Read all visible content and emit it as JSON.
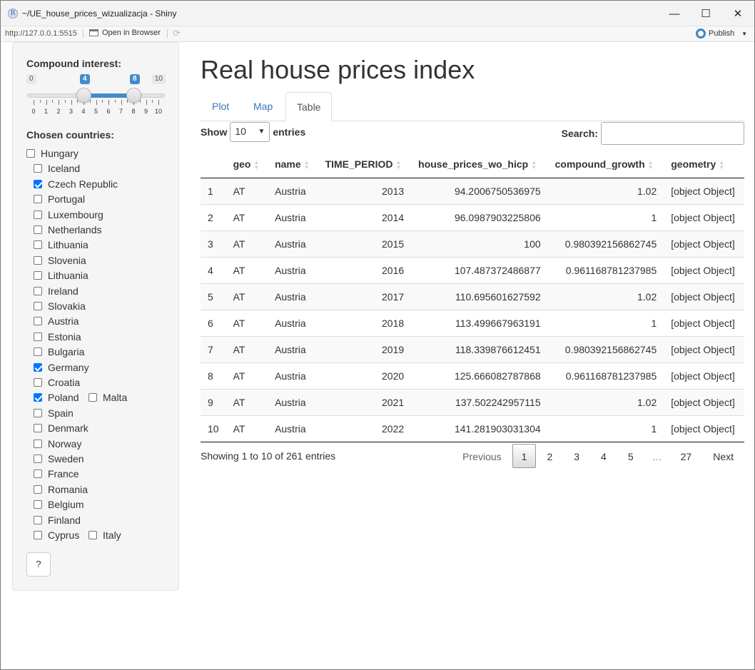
{
  "window": {
    "title": "~/UE_house_prices_wizualizacja - Shiny",
    "app_icon": "R",
    "minimize": "—",
    "maximize": "☐",
    "close": "✕"
  },
  "toolbar": {
    "url": "http://127.0.0.1:5515",
    "open_in_browser": "Open in Browser",
    "publish": "Publish"
  },
  "sidebar": {
    "compound_label": "Compound interest:",
    "slider": {
      "min": 0,
      "max": 10,
      "min_label": "0",
      "max_label": "10",
      "low": 4,
      "high": 8,
      "low_label": "4",
      "high_label": "8",
      "tick_labels": [
        "0",
        "1",
        "2",
        "3",
        "4",
        "5",
        "6",
        "7",
        "8",
        "9",
        "10"
      ]
    },
    "countries_label": "Chosen countries:",
    "countries": [
      {
        "name": "Hungary",
        "checked": false
      },
      {
        "name": "Iceland",
        "checked": false
      },
      {
        "name": "Czech Republic",
        "checked": true
      },
      {
        "name": "Portugal",
        "checked": false
      },
      {
        "name": "Luxembourg",
        "checked": false
      },
      {
        "name": "Netherlands",
        "checked": false
      },
      {
        "name": "Lithuania",
        "checked": false
      },
      {
        "name": "Slovenia",
        "checked": false
      },
      {
        "name": "Lithuania",
        "checked": false
      },
      {
        "name": "Ireland",
        "checked": false
      },
      {
        "name": "Slovakia",
        "checked": false
      },
      {
        "name": "Austria",
        "checked": false
      },
      {
        "name": "Estonia",
        "checked": false
      },
      {
        "name": "Bulgaria",
        "checked": false
      },
      {
        "name": "Germany",
        "checked": true
      },
      {
        "name": "Croatia",
        "checked": false
      },
      {
        "name": "Poland",
        "checked": true
      },
      {
        "name": "Malta",
        "checked": false
      },
      {
        "name": "Spain",
        "checked": false
      },
      {
        "name": "Denmark",
        "checked": false
      },
      {
        "name": "Norway",
        "checked": false
      },
      {
        "name": "Sweden",
        "checked": false
      },
      {
        "name": "France",
        "checked": false
      },
      {
        "name": "Romania",
        "checked": false
      },
      {
        "name": "Belgium",
        "checked": false
      },
      {
        "name": "Finland",
        "checked": false
      },
      {
        "name": "Cyprus",
        "checked": false
      },
      {
        "name": "Italy",
        "checked": false
      }
    ],
    "help_label": "?"
  },
  "main": {
    "title": "Real house prices index",
    "tabs": [
      {
        "label": "Plot",
        "active": false
      },
      {
        "label": "Map",
        "active": false
      },
      {
        "label": "Table",
        "active": true
      }
    ],
    "show_label": "Show",
    "entries_value": "10",
    "entries_label": "entries",
    "search_label": "Search:",
    "search_value": "",
    "columns": [
      "",
      "geo",
      "name",
      "TIME_PERIOD",
      "house_prices_wo_hicp",
      "compound_growth",
      "geometry"
    ],
    "rows": [
      [
        "1",
        "AT",
        "Austria",
        "2013",
        "94.2006750536975",
        "1.02",
        "[object Object]"
      ],
      [
        "2",
        "AT",
        "Austria",
        "2014",
        "96.0987903225806",
        "1",
        "[object Object]"
      ],
      [
        "3",
        "AT",
        "Austria",
        "2015",
        "100",
        "0.980392156862745",
        "[object Object]"
      ],
      [
        "4",
        "AT",
        "Austria",
        "2016",
        "107.487372486877",
        "0.961168781237985",
        "[object Object]"
      ],
      [
        "5",
        "AT",
        "Austria",
        "2017",
        "110.695601627592",
        "1.02",
        "[object Object]"
      ],
      [
        "6",
        "AT",
        "Austria",
        "2018",
        "113.499667963191",
        "1",
        "[object Object]"
      ],
      [
        "7",
        "AT",
        "Austria",
        "2019",
        "118.339876612451",
        "0.980392156862745",
        "[object Object]"
      ],
      [
        "8",
        "AT",
        "Austria",
        "2020",
        "125.666082787868",
        "0.961168781237985",
        "[object Object]"
      ],
      [
        "9",
        "AT",
        "Austria",
        "2021",
        "137.502242957115",
        "1.02",
        "[object Object]"
      ],
      [
        "10",
        "AT",
        "Austria",
        "2022",
        "141.281903031304",
        "1",
        "[object Object]"
      ]
    ],
    "info": "Showing 1 to 10 of 261 entries",
    "pagination": {
      "previous": "Previous",
      "pages": [
        "1",
        "2",
        "3",
        "4",
        "5",
        "…",
        "27"
      ],
      "current": "1",
      "next": "Next"
    }
  }
}
